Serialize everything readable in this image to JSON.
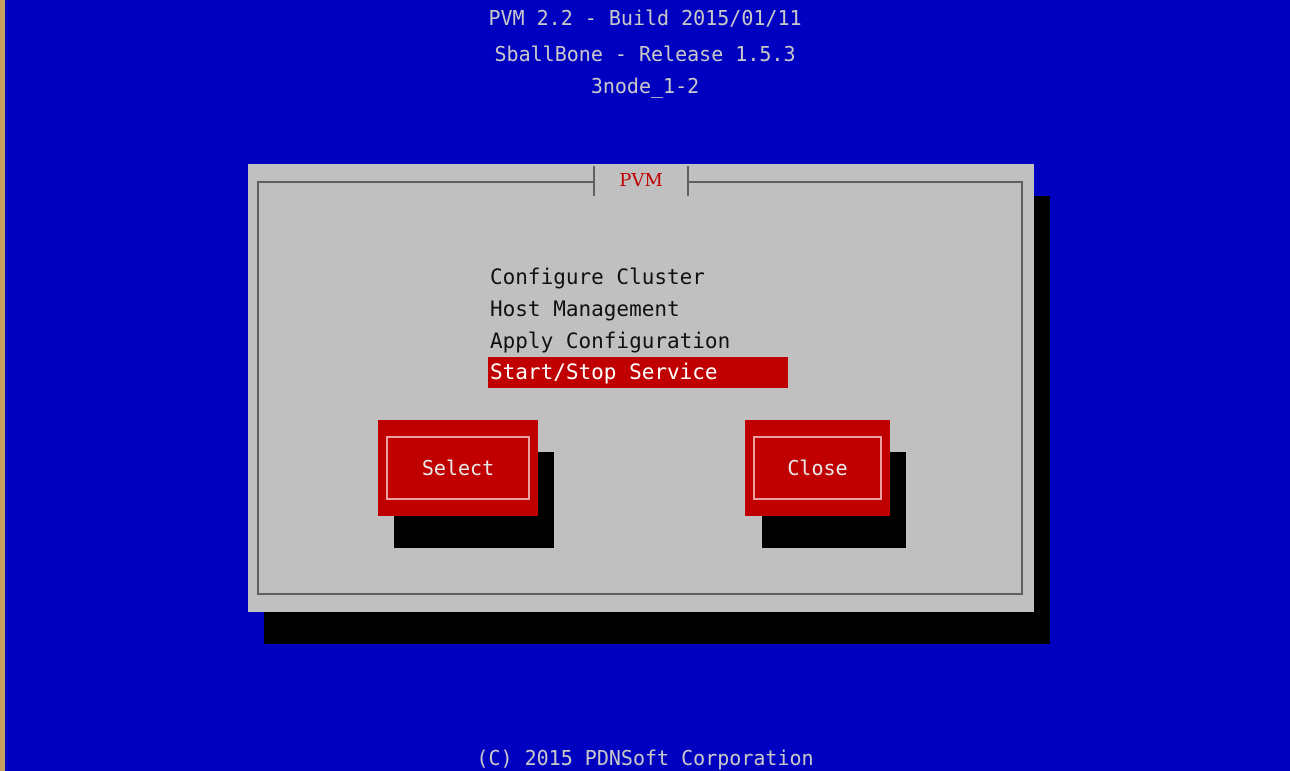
{
  "header": {
    "line1": "PVM 2.2 - Build 2015/01/11",
    "line2": "SballBone - Release 1.5.3",
    "line3": "3node_1-2"
  },
  "dialog": {
    "title": "PVM",
    "menu_items": [
      "Configure Cluster",
      "Host Management",
      "Apply Configuration",
      "Start/Stop Service"
    ],
    "selected_index": 3,
    "buttons": {
      "select_label": "Select",
      "close_label": "Close"
    }
  },
  "footer": {
    "copyright": "(C) 2015 PDNSoft Corporation"
  },
  "colors": {
    "background": "#0000c0",
    "dialog": "#c0c0c0",
    "accent": "#c00000",
    "text_light": "#c8c8c8"
  }
}
